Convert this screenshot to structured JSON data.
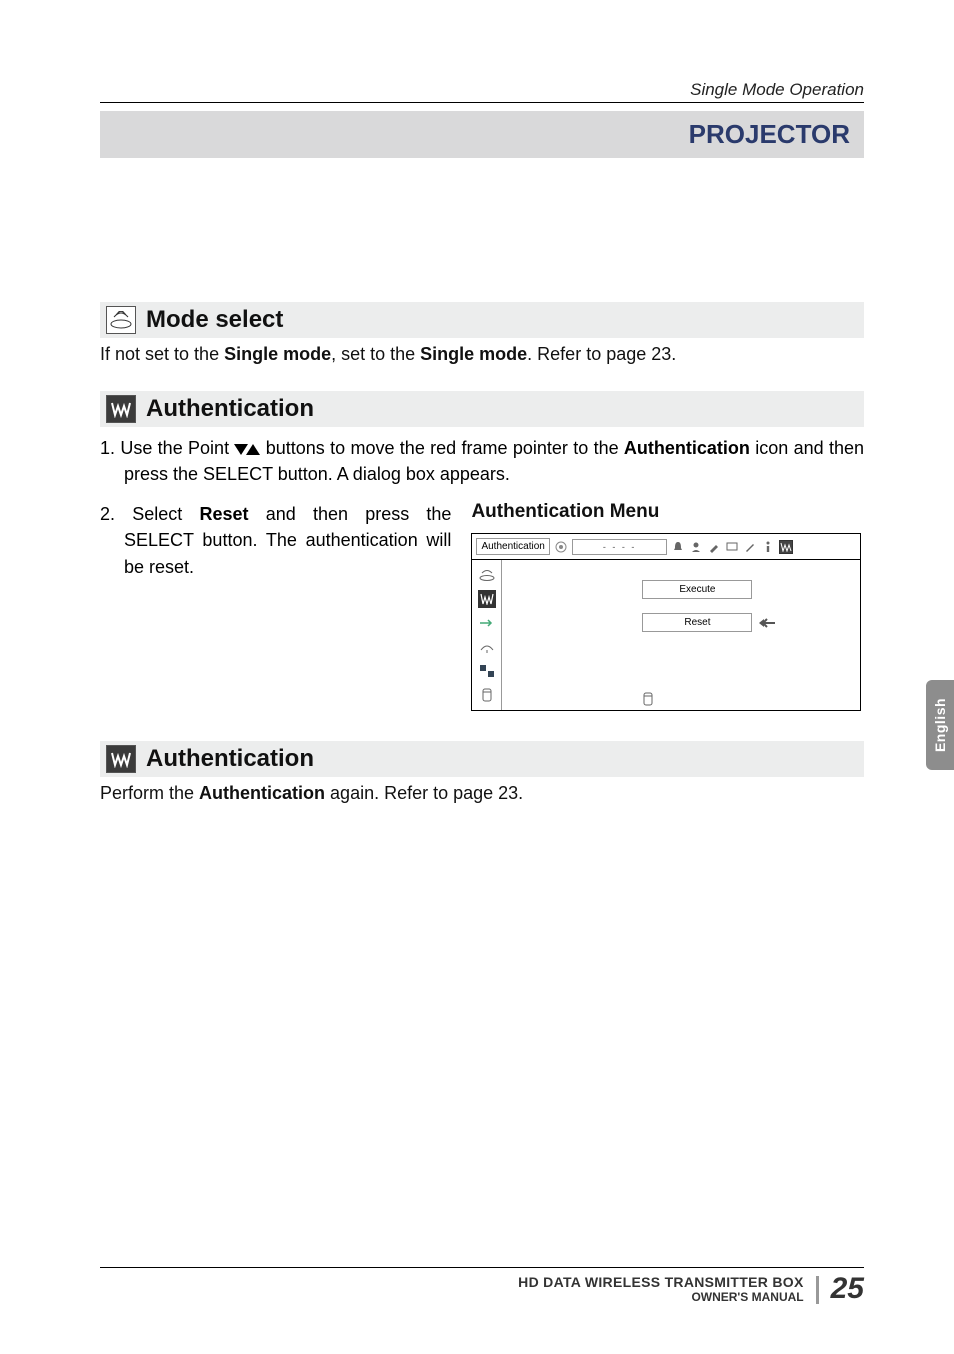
{
  "header": {
    "breadcrumb": "Single Mode Operation",
    "title": "PROJECTOR"
  },
  "mode_select": {
    "title": "Mode select",
    "text_pre": "If not set to the ",
    "bold1": "Single mode",
    "mid": ", set to the ",
    "bold2": "Single mode",
    "tail": ". Refer to page 23."
  },
  "auth1": {
    "title": "Authentication",
    "step1_pre": "1.  Use the Point ",
    "step1_mid": " buttons to move the red frame pointer to the ",
    "step1_bold": "Authentication",
    "step1_tail": " icon and then press the SELECT button. A dialog box appears.",
    "step2_pre": "2. Select ",
    "step2_bold": "Reset",
    "step2_tail": " and then press the SELECT button. The authentication will be reset."
  },
  "auth_menu": {
    "title": "Authentication Menu",
    "topbar_label": "Authentication",
    "dashes": "- - - -",
    "execute": "Execute",
    "reset": "Reset"
  },
  "auth2": {
    "title": "Authentication",
    "text_pre": "Perform the ",
    "bold": "Authentication",
    "tail": " again. Refer to page 23."
  },
  "side_tab": "English",
  "footer": {
    "line1": "HD DATA WIRELESS TRANSMITTER BOX",
    "line2": "OWNER'S MANUAL",
    "page": "25"
  }
}
